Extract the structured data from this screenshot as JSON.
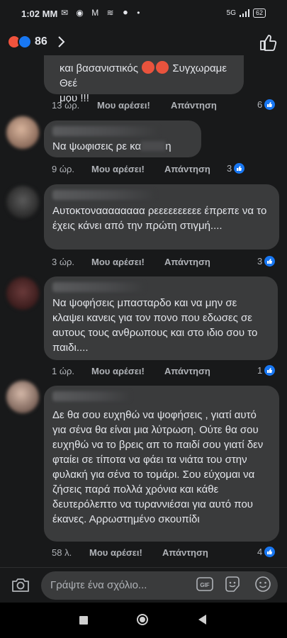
{
  "status_bar": {
    "time": "1:02 ΜΜ",
    "icons": "✉ ◉ M ≋ ⚫ •",
    "network": "5G",
    "battery": "62"
  },
  "header": {
    "reaction_count": "86",
    "reactions": [
      "angry",
      "like"
    ],
    "accent_color": "#1877f2"
  },
  "comments": [
    {
      "text_line1": "και βασανιστικός",
      "text_line1b": "Συγχωραμε Θεέ",
      "text_line2": "μου !!!",
      "time": "13 ώρ.",
      "like_label": "Μου αρέσει!",
      "reply_label": "Απάντηση",
      "likes": "6"
    },
    {
      "text": "Να ψωφισεις ρε κα",
      "text_tail": "η",
      "time": "9 ώρ.",
      "like_label": "Μου αρέσει!",
      "reply_label": "Απάντηση",
      "likes": "3"
    },
    {
      "text": "Αυτοκτοναααααααα ρεεεεεεεεεε έπρεπε να το έχεις κάνει από την πρώτη στιγμή....",
      "time": "3 ώρ.",
      "like_label": "Μου αρέσει!",
      "reply_label": "Απάντηση",
      "likes": "3"
    },
    {
      "text": "Να ψοφήσεις μπασταρδο και να μην σε κλαψει κανεις για τον πονο που εδωσες σε αυτους τους ανθρωπους και στο ιδιο σου το παιδι....",
      "time": "1 ώρ.",
      "like_label": "Μου αρέσει!",
      "reply_label": "Απάντηση",
      "likes": "1"
    },
    {
      "text": "Δε θα σου ευχηθώ να ψοφήσεις , γιατί αυτό για σένα θα είναι μια λύτρωση. Ούτε θα σου ευχηθώ να το βρεις απ το παιδί σου γιατί δεν φταίει σε τίποτα να φάει τα νιάτα του στην φυλακή για σένα το τομάρι. Σου εύχομαι να ζήσεις παρά πολλά χρόνια και κάθε δευτερόλεπτο να τυραννιέσαι για αυτό που έκανες. Αρρωστημένο σκουπίδι",
      "time": "58 λ.",
      "like_label": "Μου αρέσει!",
      "reply_label": "Απάντηση",
      "likes": "4"
    }
  ],
  "composer": {
    "placeholder": "Γράψτε ένα σχόλιο..."
  }
}
